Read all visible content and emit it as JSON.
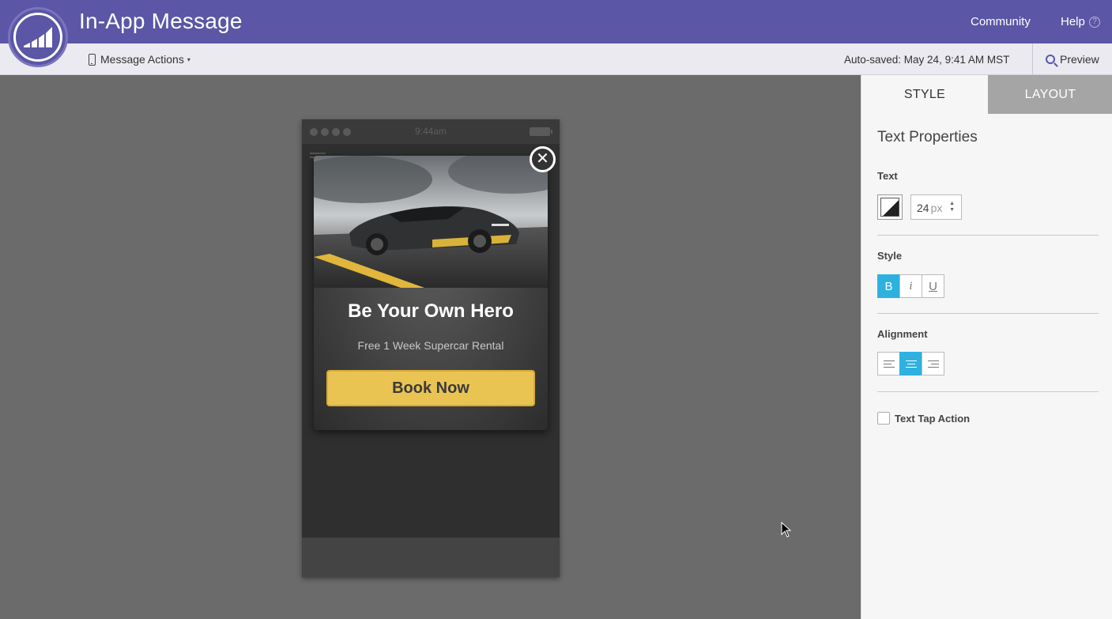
{
  "header": {
    "title": "In-App Message",
    "community": "Community",
    "help": "Help",
    "help_icon": "?"
  },
  "toolbar": {
    "message_actions": "Message Actions",
    "caret": "▾",
    "autosaved": "Auto-saved: May 24, 9:41 AM MST",
    "preview": "Preview"
  },
  "phone": {
    "time": "9:44am"
  },
  "popup": {
    "close_symbol": "✕",
    "headline": "Be Your Own Hero",
    "subline": "Free 1 Week Supercar Rental",
    "cta": "Book Now"
  },
  "panel": {
    "tabs": [
      "STYLE",
      "LAYOUT"
    ],
    "active_tab": "STYLE",
    "section_title": "Text Properties",
    "text_label": "Text",
    "font_size": "24",
    "font_unit": "px",
    "style_label": "Style",
    "style_buttons": [
      "B",
      "i",
      "U"
    ],
    "style_active": "B",
    "alignment_label": "Alignment",
    "alignment_active": "center",
    "tap_action_label": "Text Tap Action"
  },
  "colors": {
    "brand": "#5c56a6",
    "accent": "#2fb1e0",
    "cta": "#eac453"
  }
}
